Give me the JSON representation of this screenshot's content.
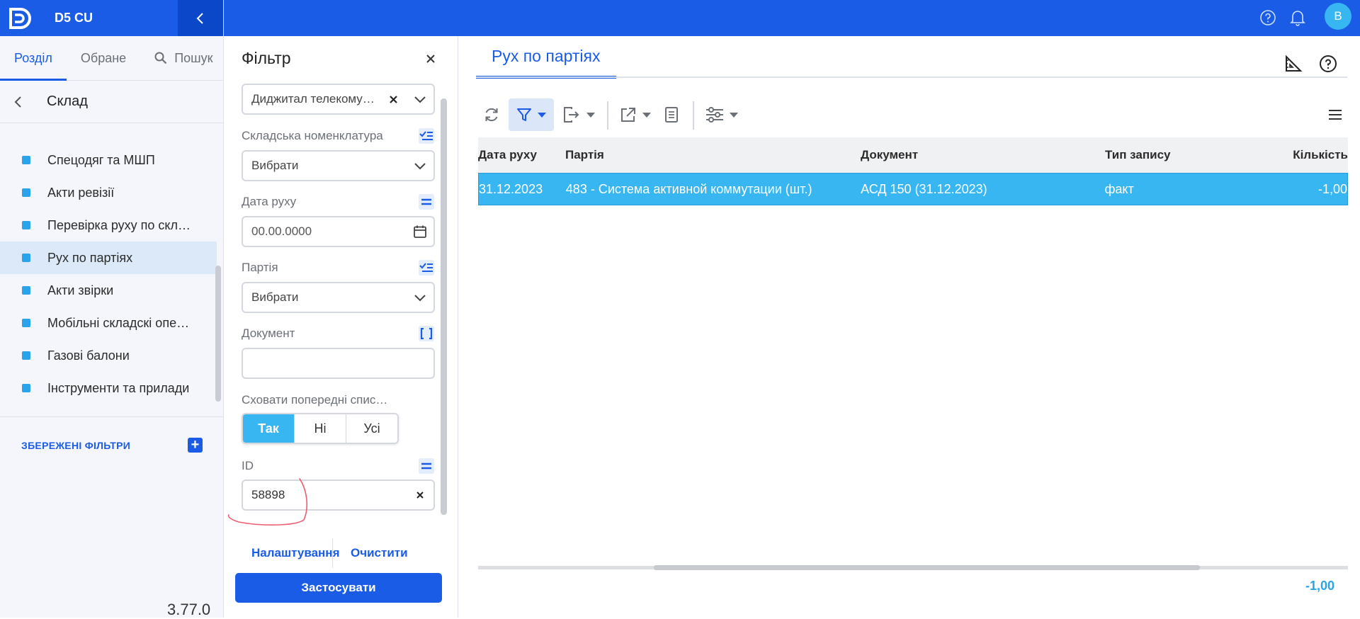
{
  "app": {
    "name": "D5 CU",
    "version": "3.77.0"
  },
  "topbar": {
    "avatar_letter": "В"
  },
  "sidebar": {
    "tabs": [
      "Розділ",
      "Обране",
      "Пошук"
    ],
    "section_title": "Склад",
    "items": [
      {
        "label": "Спецодяг та МШП"
      },
      {
        "label": "Акти ревізії"
      },
      {
        "label": "Перевірка руху по складах"
      },
      {
        "label": "Рух по партіях"
      },
      {
        "label": "Акти звірки"
      },
      {
        "label": "Мобільні складскі операції"
      },
      {
        "label": "Газові балони"
      },
      {
        "label": "Інструменти та прилади"
      }
    ],
    "saved_filters_title": "ЗБЕРЕЖЕНІ ФІЛЬТРИ"
  },
  "filter": {
    "title": "Фільтр",
    "top_field_value": "Диджитал телекомунікації",
    "nomenclature_label": "Складська номенклатура",
    "nomenclature_value": "Вибрати",
    "date_label": "Дата руху",
    "date_placeholder": "00.00.0000",
    "batch_label": "Партія",
    "batch_value": "Вибрати",
    "document_label": "Документ",
    "document_value": "",
    "hide_label": "Сховати попередні списання",
    "hide_options": [
      "Так",
      "Ні",
      "Усі"
    ],
    "id_label": "ID",
    "id_value": "58898",
    "settings_link": "Налаштування",
    "clear_link": "Очистити",
    "apply_label": "Застосувати"
  },
  "main": {
    "tab_title": "Рух по партіях",
    "columns": [
      "Дата руху",
      "Партія",
      "Документ",
      "Тип запису",
      "Кількість"
    ],
    "rows": [
      {
        "date": "31.12.2023",
        "batch": "483 - Система активной коммутации (шт.)",
        "document": "АСД 150 (31.12.2023)",
        "type": "факт",
        "qty": "-1,00"
      }
    ],
    "total_qty": "-1,00"
  },
  "colors": {
    "brand": "#1a5ce6",
    "accent": "#38b6f1"
  }
}
